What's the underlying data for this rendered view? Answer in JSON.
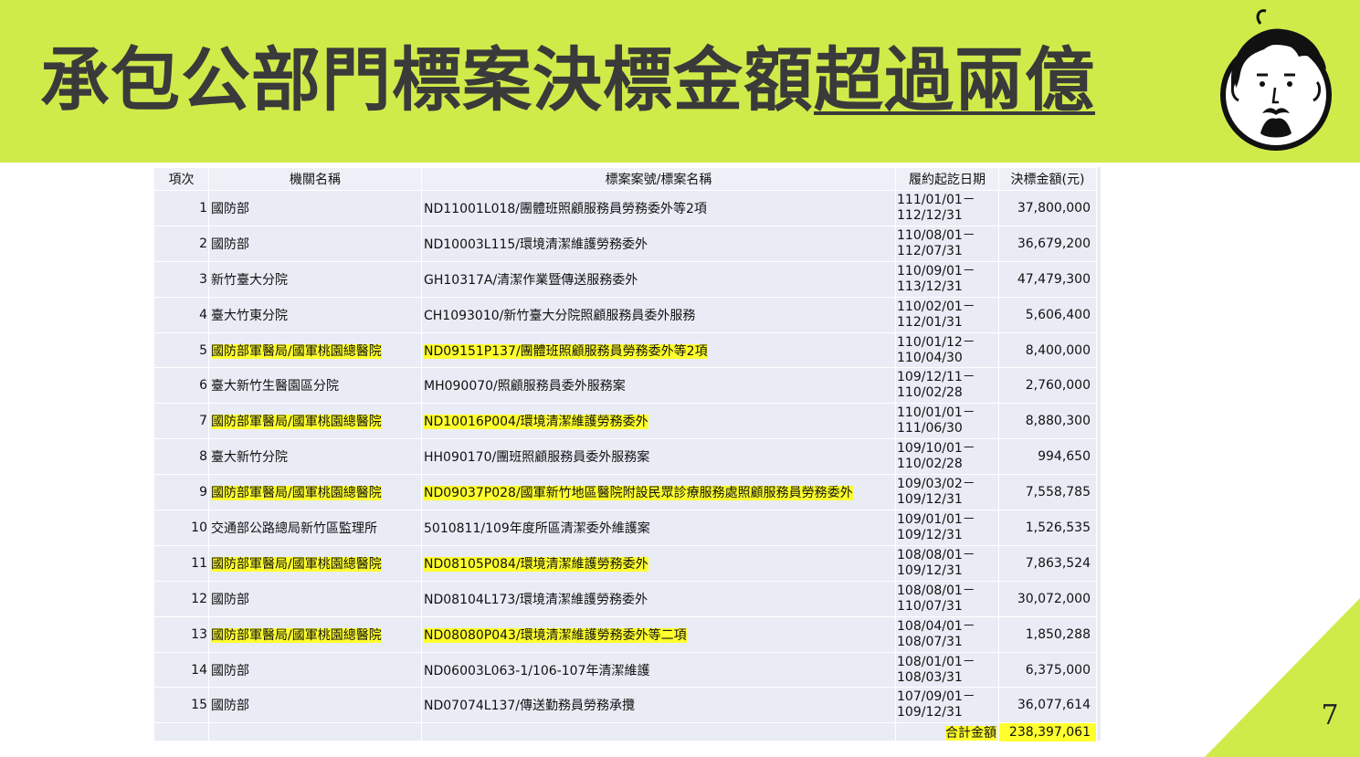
{
  "slide": {
    "title_main": "承包公部門標案決標金額",
    "title_emph": "超過兩億",
    "page_number": "7"
  },
  "table": {
    "headers": [
      "項次",
      "機關名稱",
      "標案案號/標案名稱",
      "履約起訖日期",
      "決標金額(元)"
    ],
    "rows": [
      {
        "idx": "1",
        "agency": "國防部",
        "case": "ND11001L018/團體班照顧服務員勞務委外等2項",
        "date": "111/01/01－112/12/31",
        "amount": "37,800,000",
        "highlight": false
      },
      {
        "idx": "2",
        "agency": "國防部",
        "case": "ND10003L115/環境清潔維護勞務委外",
        "date": "110/08/01－112/07/31",
        "amount": "36,679,200",
        "highlight": false
      },
      {
        "idx": "3",
        "agency": "新竹臺大分院",
        "case": "GH10317A/清潔作業暨傳送服務委外",
        "date": "110/09/01－113/12/31",
        "amount": "47,479,300",
        "highlight": false
      },
      {
        "idx": "4",
        "agency": "臺大竹東分院",
        "case": "CH1093010/新竹臺大分院照顧服務員委外服務",
        "date": "110/02/01－112/01/31",
        "amount": "5,606,400",
        "highlight": false
      },
      {
        "idx": "5",
        "agency": "國防部軍醫局/國軍桃園總醫院",
        "case": "ND09151P137/團體班照顧服務員勞務委外等2項",
        "date": "110/01/12－110/04/30",
        "amount": "8,400,000",
        "highlight": true
      },
      {
        "idx": "6",
        "agency": "臺大新竹生醫園區分院",
        "case": "MH090070/照顧服務員委外服務案",
        "date": "109/12/11－110/02/28",
        "amount": "2,760,000",
        "highlight": false
      },
      {
        "idx": "7",
        "agency": "國防部軍醫局/國軍桃園總醫院",
        "case": "ND10016P004/環境清潔維護勞務委外",
        "date": "110/01/01－111/06/30",
        "amount": "8,880,300",
        "highlight": true
      },
      {
        "idx": "8",
        "agency": "臺大新竹分院",
        "case": "HH090170/團班照顧服務員委外服務案",
        "date": "109/10/01－110/02/28",
        "amount": "994,650",
        "highlight": false
      },
      {
        "idx": "9",
        "agency": "國防部軍醫局/國軍桃園總醫院",
        "case": "ND09037P028/國軍新竹地區醫院附設民眾診療服務處照顧服務員勞務委外",
        "date": "109/03/02－109/12/31",
        "amount": "7,558,785",
        "highlight": true
      },
      {
        "idx": "10",
        "agency": "交通部公路總局新竹區監理所",
        "case": "5010811/109年度所區清潔委外維護案",
        "date": "109/01/01－109/12/31",
        "amount": "1,526,535",
        "highlight": false
      },
      {
        "idx": "11",
        "agency": "國防部軍醫局/國軍桃園總醫院",
        "case": "ND08105P084/環境清潔維護勞務委外",
        "date": "108/08/01－109/12/31",
        "amount": "7,863,524",
        "highlight": true
      },
      {
        "idx": "12",
        "agency": "國防部",
        "case": "ND08104L173/環境清潔維護勞務委外",
        "date": "108/08/01－110/07/31",
        "amount": "30,072,000",
        "highlight": false
      },
      {
        "idx": "13",
        "agency": "國防部軍醫局/國軍桃園總醫院",
        "case": "ND08080P043/環境清潔維護勞務委外等二項",
        "date": "108/04/01－108/07/31",
        "amount": "1,850,288",
        "highlight": true
      },
      {
        "idx": "14",
        "agency": "國防部",
        "case": "ND06003L063-1/106-107年清潔維護",
        "date": "108/01/01－108/03/31",
        "amount": "6,375,000",
        "highlight": false
      },
      {
        "idx": "15",
        "agency": "國防部",
        "case": "ND07074L137/傳送勤務員勞務承攬",
        "date": "107/09/01－109/12/31",
        "amount": "36,077,614",
        "highlight": false
      }
    ],
    "total_label": "合計金額",
    "total_amount": "238,397,061"
  },
  "colors": {
    "header_band": "#cfeb4a",
    "highlight": "#ffff2e",
    "table_bg": "#e9ecf5",
    "title_text": "#3a3a3a"
  },
  "icons": {
    "avatar": "cartoon-man-face-icon",
    "corner": "green-triangle-decoration"
  }
}
